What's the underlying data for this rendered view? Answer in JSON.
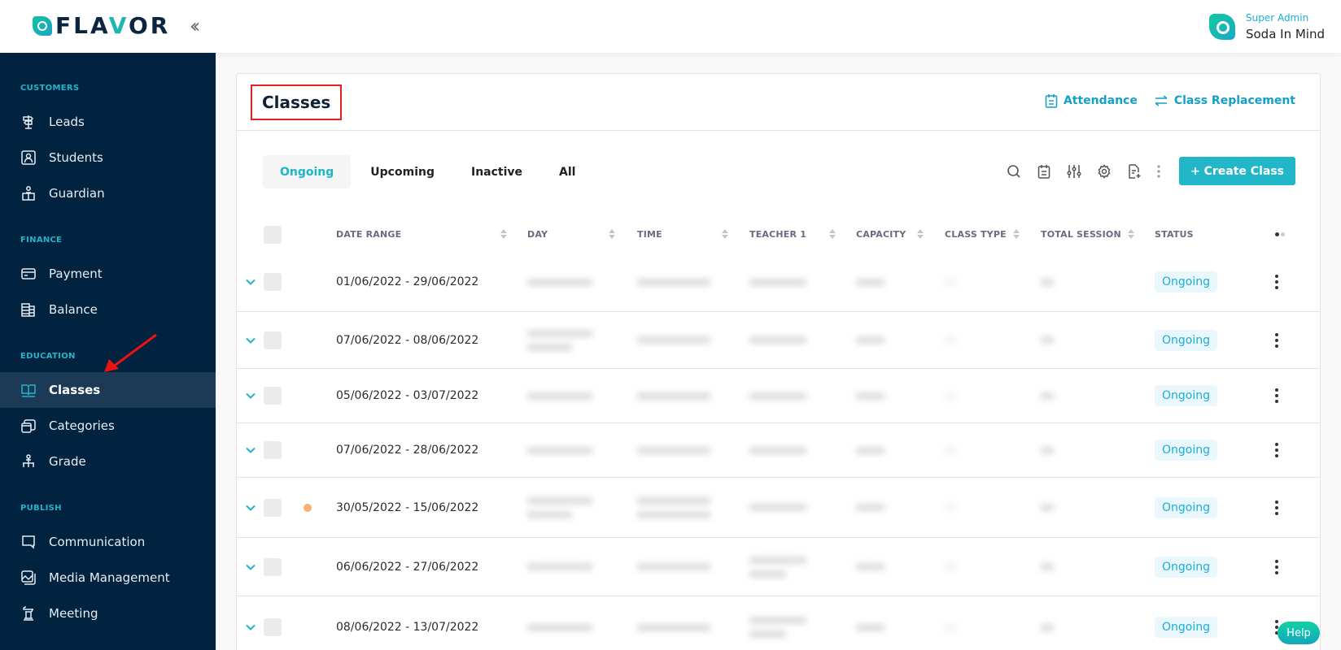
{
  "header": {
    "logo_prefix": "FLA",
    "logo_v": "V",
    "logo_suffix": "OR",
    "collapse_icon": "double-chevron-left-icon",
    "user_role": "Super Admin",
    "user_name": "Soda In Mind"
  },
  "sidebar": {
    "sections": [
      {
        "title": "CUSTOMERS",
        "items": [
          {
            "label": "Leads",
            "icon": "signpost-icon"
          },
          {
            "label": "Students",
            "icon": "student-card-icon"
          },
          {
            "label": "Guardian",
            "icon": "guardian-icon"
          }
        ]
      },
      {
        "title": "FINANCE",
        "items": [
          {
            "label": "Payment",
            "icon": "credit-card-icon"
          },
          {
            "label": "Balance",
            "icon": "ledger-icon"
          }
        ]
      },
      {
        "title": "EDUCATION",
        "items": [
          {
            "label": "Classes",
            "icon": "book-open-icon",
            "active": true
          },
          {
            "label": "Categories",
            "icon": "layers-icon"
          },
          {
            "label": "Grade",
            "icon": "hierarchy-icon"
          }
        ]
      },
      {
        "title": "PUBLISH",
        "items": [
          {
            "label": "Communication",
            "icon": "chat-icon"
          },
          {
            "label": "Media Management",
            "icon": "image-gallery-icon"
          },
          {
            "label": "Meeting",
            "icon": "podium-icon"
          }
        ]
      }
    ]
  },
  "page": {
    "title": "Classes",
    "links": {
      "attendance": "Attendance",
      "class_replacement": "Class Replacement"
    },
    "tabs": [
      {
        "label": "Ongoing",
        "active": true
      },
      {
        "label": "Upcoming"
      },
      {
        "label": "Inactive"
      },
      {
        "label": "All"
      }
    ],
    "toolbar_icons": [
      "search-icon",
      "calendar-notes-icon",
      "sliders-icon",
      "gear-icon",
      "export-file-icon",
      "more-vertical-icon"
    ],
    "create_button": "+ Create Class"
  },
  "table": {
    "columns": [
      "DATE RANGE",
      "DAY",
      "TIME",
      "TEACHER 1",
      "CAPACITY",
      "CLASS TYPE",
      "TOTAL SESSION",
      "STATUS"
    ],
    "rows": [
      {
        "date_range": "01/06/2022 - 29/06/2022",
        "status": "Ongoing",
        "flag": false
      },
      {
        "date_range": "07/06/2022 - 08/06/2022",
        "status": "Ongoing",
        "flag": false
      },
      {
        "date_range": "05/06/2022 - 03/07/2022",
        "status": "Ongoing",
        "flag": false
      },
      {
        "date_range": "07/06/2022 - 28/06/2022",
        "status": "Ongoing",
        "flag": false
      },
      {
        "date_range": "30/05/2022 - 15/06/2022",
        "status": "Ongoing",
        "flag": true
      },
      {
        "date_range": "06/06/2022 - 27/06/2022",
        "status": "Ongoing",
        "flag": false
      },
      {
        "date_range": "08/06/2022 - 13/07/2022",
        "status": "Ongoing",
        "flag": false
      }
    ],
    "note": "Day, Time, Teacher 1, Capacity, Class Type and Total Session values are blurred/redacted in the screenshot"
  },
  "help_button": "Help",
  "colors": {
    "sidebar_bg": "#022340",
    "accent": "#21b6c8",
    "link": "#159fc9",
    "highlight_box": "#e32121",
    "flag_dot": "#f8b171"
  }
}
